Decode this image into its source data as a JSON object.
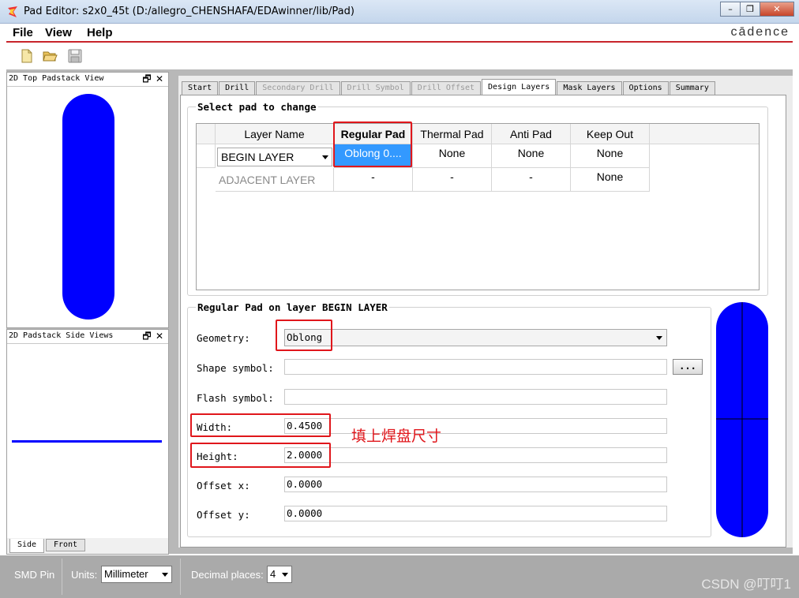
{
  "window": {
    "title": "Pad Editor: s2x0_45t  (D:/allegro_CHENSHAFA/EDAwinner/lib/Pad)",
    "minimize": "–",
    "restore": "❐",
    "close": "✕"
  },
  "menu": {
    "file": "File",
    "view": "View",
    "help": "Help"
  },
  "brand": "cādence",
  "left_panels": {
    "top_view_title": "2D Top Padstack View",
    "side_view_title": "2D Padstack Side Views",
    "float_glyph": "🗗",
    "close_glyph": "✕",
    "side_tabs": [
      "Side",
      "Front"
    ]
  },
  "tabs": [
    "Start",
    "Drill",
    "Secondary Drill",
    "Drill Symbol",
    "Drill Offset",
    "Design Layers",
    "Mask Layers",
    "Options",
    "Summary"
  ],
  "select_group": {
    "title": "Select pad to change",
    "columns": [
      "Layer Name",
      "Regular Pad",
      "Thermal Pad",
      "Anti Pad",
      "Keep Out"
    ],
    "rows": [
      {
        "layer": "BEGIN LAYER",
        "regular": "Oblong 0....",
        "thermal": "None",
        "anti": "None",
        "keepout": "None"
      },
      {
        "layer": "ADJACENT LAYER",
        "regular": "-",
        "thermal": "-",
        "anti": "-",
        "keepout": "None"
      }
    ]
  },
  "pad_group": {
    "title": "Regular Pad on layer BEGIN LAYER",
    "geometry_label": "Geometry:",
    "geometry_value": "Oblong",
    "shape_label": "Shape symbol:",
    "shape_value": "",
    "browse_label": "...",
    "flash_label": "Flash symbol:",
    "flash_value": "",
    "width_label": "Width:",
    "width_value": "0.4500",
    "height_label": "Height:",
    "height_value": "2.0000",
    "offx_label": "Offset x:",
    "offx_value": "0.0000",
    "offy_label": "Offset y:",
    "offy_value": "0.0000"
  },
  "annotation": "填上焊盘尺寸",
  "status": {
    "pin_type": "SMD Pin",
    "units_label": "Units:",
    "units_value": "Millimeter",
    "decimal_label": "Decimal places:",
    "decimal_value": "4"
  },
  "watermark": "CSDN @叮叮1",
  "colors": {
    "pad": "#0000ff",
    "highlight": "#e0161b",
    "selection": "#3399ff"
  }
}
